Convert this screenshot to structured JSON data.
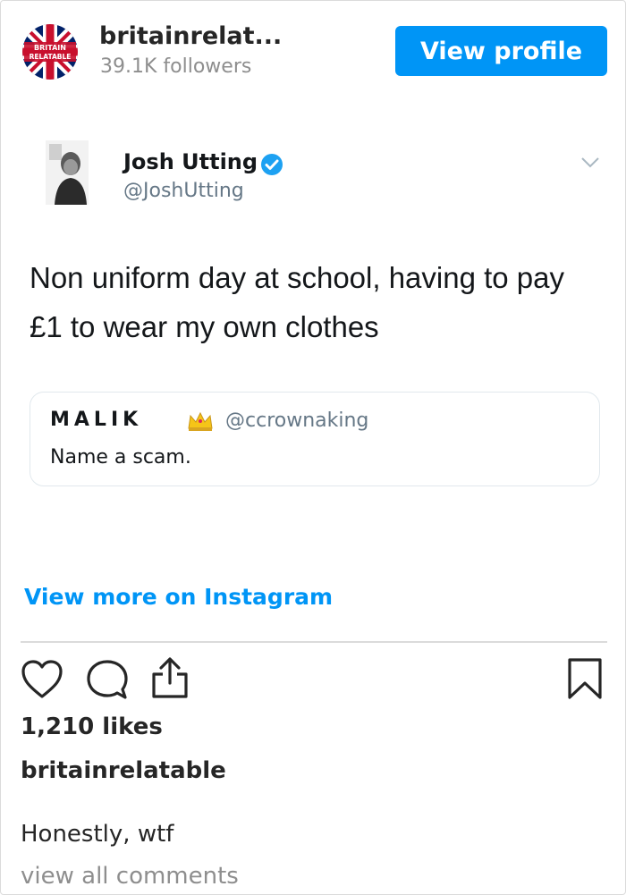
{
  "header": {
    "avatar_text_top": "BRITAIN",
    "avatar_text_bottom": "RELATABLE",
    "account_name": "britainrelat...",
    "followers": "39.1K followers",
    "view_profile_label": "View profile"
  },
  "tweet": {
    "author_name": "Josh Utting",
    "author_handle": "@JoshUtting",
    "text": "Non uniform day at school, having to pay £1 to wear my own clothes",
    "quoted": {
      "name": "MALIK",
      "handle": "@ccrownaking",
      "text": "Name a scam."
    }
  },
  "view_more_label": "View more on Instagram",
  "likes": "1,210 likes",
  "owner": "britainrelatable",
  "caption": "Honestly, wtf",
  "view_comments_label": "view all comments",
  "colors": {
    "accent": "#0095f6",
    "twitter_verified": "#1da1f2",
    "text": "#262626",
    "muted": "#8e8e8e"
  },
  "icons": [
    "union-jack-icon",
    "verified-badge-icon",
    "chevron-down-icon",
    "crown-icon",
    "heart-icon",
    "comment-icon",
    "share-icon",
    "bookmark-icon"
  ]
}
